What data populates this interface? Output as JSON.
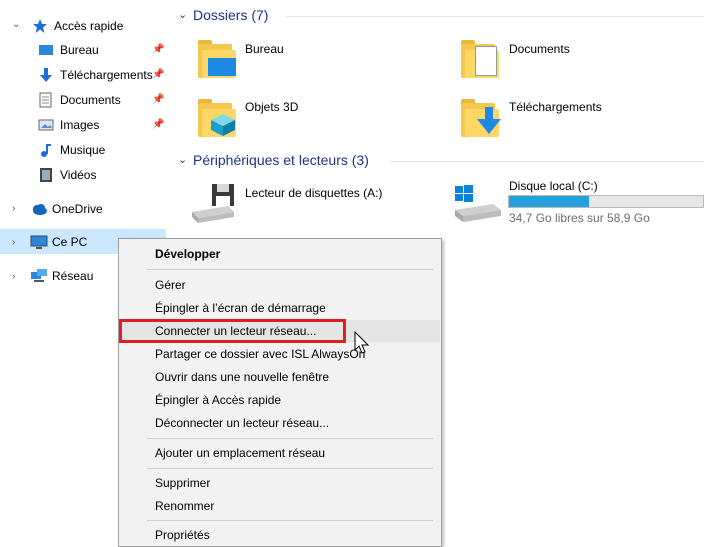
{
  "nav": {
    "quick_access": "Accès rapide",
    "items": [
      {
        "label": "Bureau"
      },
      {
        "label": "Téléchargements"
      },
      {
        "label": "Documents"
      },
      {
        "label": "Images"
      },
      {
        "label": "Musique"
      },
      {
        "label": "Vidéos"
      }
    ],
    "onedrive": "OneDrive",
    "this_pc": "Ce PC",
    "network": "Réseau"
  },
  "main": {
    "folders_header": "Dossiers (7)",
    "folders": [
      {
        "label": "Bureau"
      },
      {
        "label": "Documents"
      },
      {
        "label": "Objets 3D"
      },
      {
        "label": "Téléchargements"
      }
    ],
    "devices_header": "Périphériques et lecteurs (3)",
    "devices": [
      {
        "label": "Lecteur de disquettes (A:)"
      },
      {
        "label": "Disque local (C:)",
        "free_text": "34,7 Go libres sur 58,9 Go",
        "used_fraction": 0.41
      }
    ]
  },
  "context_menu": {
    "items": [
      {
        "label": "Développer"
      },
      {
        "label": "Gérer"
      },
      {
        "label": "Épingler à l’écran de démarrage"
      },
      {
        "label": "Connecter un lecteur réseau..."
      },
      {
        "label": "Partager ce dossier avec ISL AlwaysOn"
      },
      {
        "label": "Ouvrir dans une nouvelle fenêtre"
      },
      {
        "label": "Épingler à Accès rapide"
      },
      {
        "label": "Déconnecter un lecteur réseau..."
      },
      {
        "label": "Ajouter un emplacement réseau"
      },
      {
        "label": "Supprimer"
      },
      {
        "label": "Renommer"
      },
      {
        "label": "Propriétés"
      }
    ]
  },
  "colors": {
    "accent": "#1e3287",
    "highlight_box": "#e01c24",
    "selection": "#cce8ff",
    "drive_fill": "#26a0da"
  }
}
